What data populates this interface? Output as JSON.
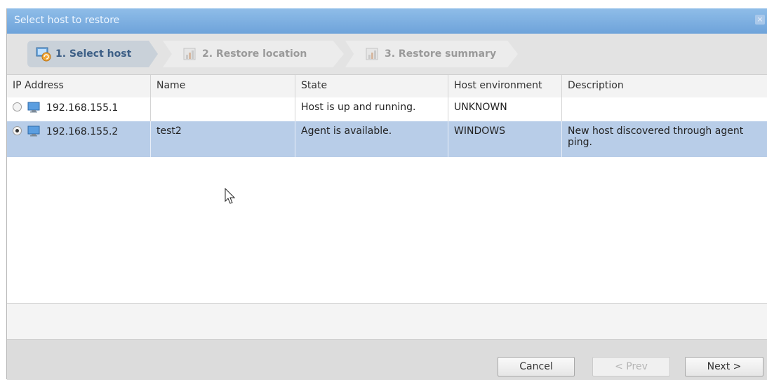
{
  "dialog": {
    "title": "Select host to restore",
    "close_glyph": "×"
  },
  "wizard": {
    "steps": [
      {
        "label": "1. Select host",
        "icon": "host-restore-icon",
        "active": true
      },
      {
        "label": "2. Restore location",
        "icon": "chart-icon",
        "active": false
      },
      {
        "label": "3. Restore summary",
        "icon": "chart-icon",
        "active": false
      }
    ]
  },
  "table": {
    "columns": [
      "IP Address",
      "Name",
      "State",
      "Host environment",
      "Description"
    ],
    "rows": [
      {
        "ip": "192.168.155.1",
        "name": "",
        "state": "Host is up and running.",
        "env": "UNKNOWN",
        "description": "",
        "selected": false
      },
      {
        "ip": "192.168.155.2",
        "name": "test2",
        "state": "Agent is available.",
        "env": "WINDOWS",
        "description": "New host discovered through agent ping.",
        "selected": true
      }
    ]
  },
  "buttons": {
    "cancel": "Cancel",
    "prev": "< Prev",
    "next": "Next >"
  },
  "colors": {
    "titlebar": "#7fb0e2",
    "selected_row": "#b8cde8",
    "active_step_text": "#3d5f86"
  }
}
